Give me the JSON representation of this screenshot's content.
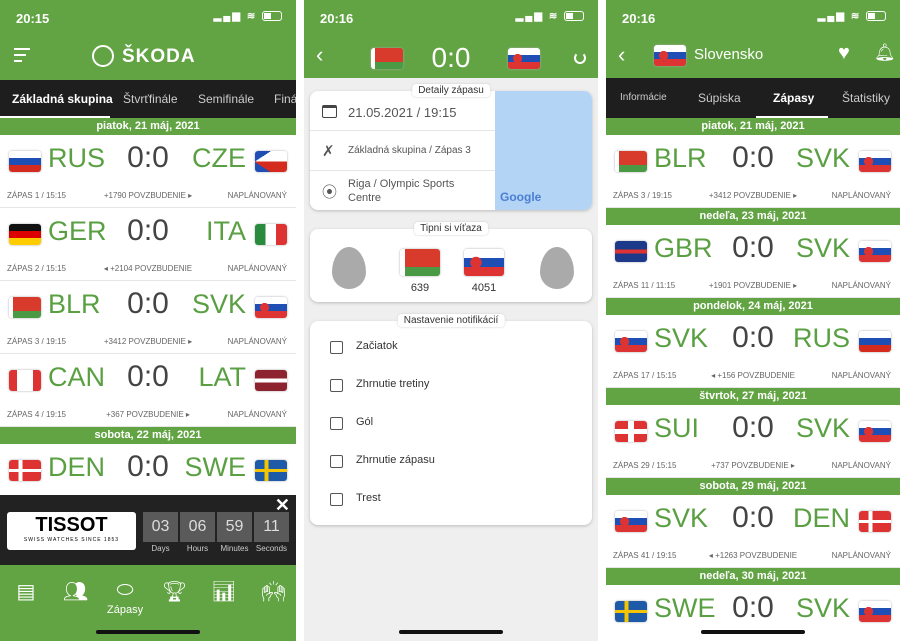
{
  "colors": {
    "green": "#62a443",
    "dark": "#1e1e1e",
    "team": "#5aa043"
  },
  "p1": {
    "time": "20:15",
    "brand": "ŠKODA",
    "tabs": [
      "Základná skupina",
      "Štvrťfinále",
      "Semifinále",
      "Finá"
    ],
    "groups": [
      {
        "date": "piatok, 21 máj, 2021",
        "matches": [
          {
            "home": "RUS",
            "away": "CZE",
            "score": "0:0",
            "meta": "ZÁPAS 1 / 15:15",
            "cheer": "+1790 POVZBUDENIE ▸",
            "status": "NAPLÁNOVANÝ"
          },
          {
            "home": "GER",
            "away": "ITA",
            "score": "0:0",
            "meta": "ZÁPAS 2 / 15:15",
            "cheer": "◂ +2104 POVZBUDENIE",
            "status": "NAPLÁNOVANÝ"
          },
          {
            "home": "BLR",
            "away": "SVK",
            "score": "0:0",
            "meta": "ZÁPAS 3 / 19:15",
            "cheer": "+3412 POVZBUDENIE ▸",
            "status": "NAPLÁNOVANÝ"
          },
          {
            "home": "CAN",
            "away": "LAT",
            "score": "0:0",
            "meta": "ZÁPAS 4 / 19:15",
            "cheer": "+367 POVZBUDENIE ▸",
            "status": "NAPLÁNOVANÝ"
          }
        ]
      },
      {
        "date": "sobota, 22 máj, 2021",
        "matches": [
          {
            "home": "DEN",
            "away": "SWE",
            "score": "0:0"
          }
        ]
      }
    ],
    "ad": {
      "brand": "TISSOT",
      "tagline": "SWISS WATCHES SINCE 1853",
      "countdown": [
        {
          "v": "03",
          "l": "Days"
        },
        {
          "v": "06",
          "l": "Hours"
        },
        {
          "v": "59",
          "l": "Minutes"
        },
        {
          "v": "11",
          "l": "Seconds"
        }
      ]
    },
    "nav": [
      {
        "icon": "news-icon"
      },
      {
        "icon": "players-icon"
      },
      {
        "icon": "puck-icon",
        "label": "Zápasy"
      },
      {
        "icon": "trophy-icon"
      },
      {
        "icon": "stats-icon"
      },
      {
        "icon": "fans-icon"
      }
    ]
  },
  "p2": {
    "time": "20:16",
    "score": "0:0",
    "home": "BLR",
    "away": "SVK",
    "details_title": "Detaily zápasu",
    "date": "21.05.2021 / 19:15",
    "stage": "Základná skupina / Zápas 3",
    "venue": "Riga / Olympic Sports Centre",
    "map_logo": "Google",
    "tip_title": "Tipni si víťaza",
    "tip_home": "639",
    "tip_away": "4051",
    "notif_title": "Nastavenie notifikácií",
    "notifs": [
      "Začiatok",
      "Zhrnutie tretiny",
      "Gól",
      "Zhrnutie zápasu",
      "Trest"
    ]
  },
  "p3": {
    "time": "20:16",
    "title": "Slovensko",
    "tabs": [
      "Informácie",
      "Súpiska",
      "Zápasy",
      "Štatistiky"
    ],
    "groups": [
      {
        "date": "piatok, 21 máj, 2021",
        "matches": [
          {
            "home": "BLR",
            "away": "SVK",
            "score": "0:0",
            "meta": "ZÁPAS 3 / 19:15",
            "cheer": "+3412 POVZBUDENIE ▸",
            "status": "NAPLÁNOVANÝ"
          }
        ]
      },
      {
        "date": "nedeľa, 23 máj, 2021",
        "matches": [
          {
            "home": "GBR",
            "away": "SVK",
            "score": "0:0",
            "meta": "ZÁPAS 11 / 11:15",
            "cheer": "+1901 POVZBUDENIE ▸",
            "status": "NAPLÁNOVANÝ"
          }
        ]
      },
      {
        "date": "pondelok, 24 máj, 2021",
        "matches": [
          {
            "home": "SVK",
            "away": "RUS",
            "score": "0:0",
            "meta": "ZÁPAS 17 / 15:15",
            "cheer": "◂ +156 POVZBUDENIE",
            "status": "NAPLÁNOVANÝ"
          }
        ]
      },
      {
        "date": "štvrtok, 27 máj, 2021",
        "matches": [
          {
            "home": "SUI",
            "away": "SVK",
            "score": "0:0",
            "meta": "ZÁPAS 29 / 15:15",
            "cheer": "+737 POVZBUDENIE ▸",
            "status": "NAPLÁNOVANÝ"
          }
        ]
      },
      {
        "date": "sobota, 29 máj, 2021",
        "matches": [
          {
            "home": "SVK",
            "away": "DEN",
            "score": "0:0",
            "meta": "ZÁPAS 41 / 19:15",
            "cheer": "◂ +1263 POVZBUDENIE",
            "status": "NAPLÁNOVANÝ"
          }
        ]
      },
      {
        "date": "nedeľa, 30 máj, 2021",
        "matches": [
          {
            "home": "SWE",
            "away": "SVK",
            "score": "0:0"
          }
        ]
      }
    ]
  }
}
